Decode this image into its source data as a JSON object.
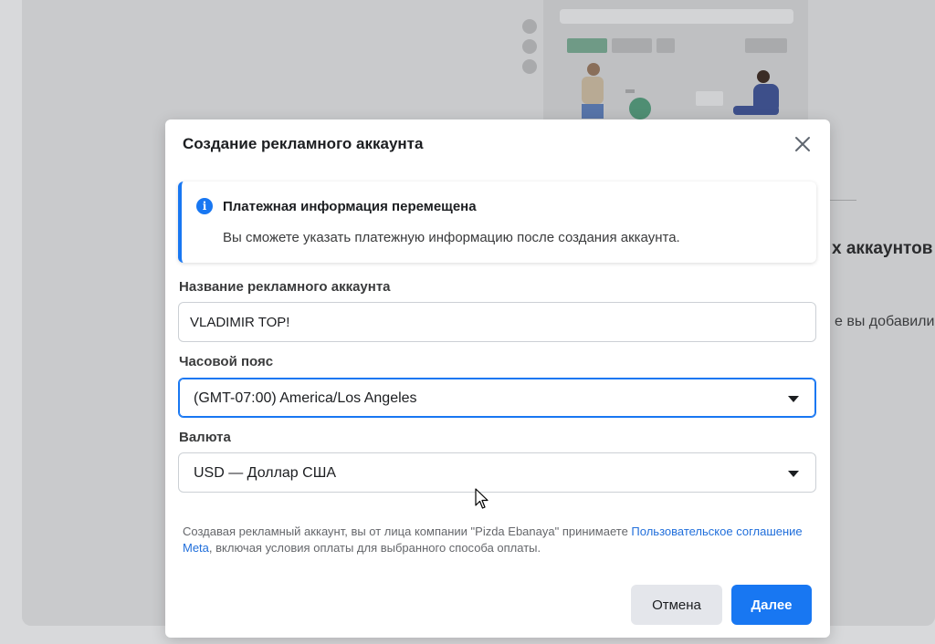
{
  "background": {
    "right_heading": "х аккаунтов",
    "right_subtext": "е вы добавили"
  },
  "dialog": {
    "title": "Создание рекламного аккаунта",
    "close_icon": "close-icon",
    "info_banner": {
      "icon": "info-icon",
      "title": "Платежная информация перемещена",
      "text": "Вы сможете указать платежную информацию после создания аккаунта."
    },
    "fields": {
      "account_name": {
        "label": "Название рекламного аккаунта",
        "value": "VLADIMIR TOP!"
      },
      "timezone": {
        "label": "Часовой пояс",
        "value": "(GMT-07:00) America/Los Angeles"
      },
      "currency": {
        "label": "Валюта",
        "value": "USD — Доллар США"
      }
    },
    "legal": {
      "prefix": "Создавая рекламный аккаунт, вы от лица компании \"Pizda Ebanaya\" принимаете ",
      "link": "Пользовательское соглашение Meta",
      "suffix": ", включая условия оплаты для выбранного способа оплаты."
    },
    "buttons": {
      "cancel": "Отмена",
      "next": "Далее"
    }
  },
  "colors": {
    "accent": "#1877f2",
    "link": "#216fdb"
  }
}
